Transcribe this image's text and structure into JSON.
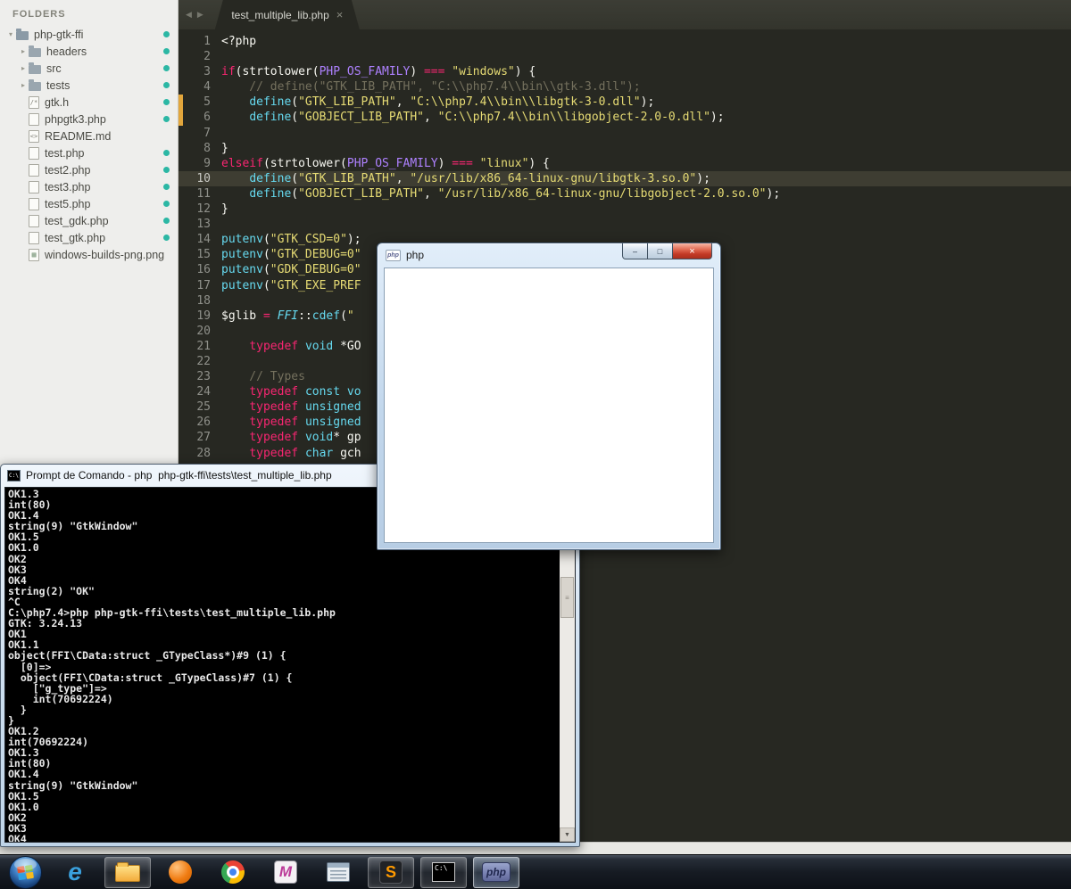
{
  "sidebar": {
    "header": "FOLDERS",
    "items": [
      {
        "label": "php-gtk-ffi",
        "icon": "folder-open",
        "arrow": "▾",
        "dot": true,
        "level": 0
      },
      {
        "label": "headers",
        "icon": "folder",
        "arrow": "▸",
        "dot": true,
        "level": 1
      },
      {
        "label": "src",
        "icon": "folder",
        "arrow": "▸",
        "dot": true,
        "level": 1
      },
      {
        "label": "tests",
        "icon": "folder",
        "arrow": "▸",
        "dot": true,
        "level": 1
      },
      {
        "label": "gtk.h",
        "icon": "file",
        "glyph": "/*",
        "dot": true,
        "level": 1
      },
      {
        "label": "phpgtk3.php",
        "icon": "file",
        "glyph": "",
        "dot": true,
        "level": 1
      },
      {
        "label": "README.md",
        "icon": "file",
        "glyph": "<>",
        "dot": false,
        "level": 1
      },
      {
        "label": "test.php",
        "icon": "file",
        "glyph": "",
        "dot": true,
        "level": 1
      },
      {
        "label": "test2.php",
        "icon": "file",
        "glyph": "",
        "dot": true,
        "level": 1
      },
      {
        "label": "test3.php",
        "icon": "file",
        "glyph": "",
        "dot": true,
        "level": 1
      },
      {
        "label": "test5.php",
        "icon": "file",
        "glyph": "",
        "dot": true,
        "level": 1
      },
      {
        "label": "test_gdk.php",
        "icon": "file",
        "glyph": "",
        "dot": true,
        "level": 1
      },
      {
        "label": "test_gtk.php",
        "icon": "file",
        "glyph": "",
        "dot": true,
        "level": 1
      },
      {
        "label": "windows-builds-png.png",
        "icon": "image",
        "glyph": "▦",
        "dot": false,
        "level": 1
      }
    ]
  },
  "tabbar": {
    "left_arrow": "◀",
    "right_arrow": "▶",
    "tabs": [
      {
        "title": "test_multiple_lib.php",
        "close": "×",
        "active": true
      }
    ]
  },
  "editor": {
    "active_line": 10,
    "lines": [
      [
        [
          "w",
          "<?php"
        ]
      ],
      [],
      [
        [
          "p",
          "if"
        ],
        [
          "w",
          "(strtolower("
        ],
        [
          "pu",
          "PHP_OS_FAMILY"
        ],
        [
          "w",
          ") "
        ],
        [
          "p",
          "==="
        ],
        [
          "w",
          " "
        ],
        [
          "y",
          "\"windows\""
        ],
        [
          "w",
          ") {"
        ]
      ],
      [
        [
          "g",
          "    // define(\"GTK_LIB_PATH\", \"C:\\\\php7.4\\\\bin\\\\gtk-3.dll\");"
        ]
      ],
      [
        [
          "w",
          "    "
        ],
        [
          "b",
          "define"
        ],
        [
          "w",
          "("
        ],
        [
          "y",
          "\"GTK_LIB_PATH\""
        ],
        [
          "w",
          ", "
        ],
        [
          "y",
          "\"C:\\\\php7.4\\\\bin\\\\libgtk-3-0.dll\""
        ],
        [
          "w",
          ");"
        ]
      ],
      [
        [
          "w",
          "    "
        ],
        [
          "b",
          "define"
        ],
        [
          "w",
          "("
        ],
        [
          "y",
          "\"GOBJECT_LIB_PATH\""
        ],
        [
          "w",
          ", "
        ],
        [
          "y",
          "\"C:\\\\php7.4\\\\bin\\\\libgobject-2.0-0.dll\""
        ],
        [
          "w",
          ");"
        ]
      ],
      [],
      [
        [
          "w",
          "}"
        ]
      ],
      [
        [
          "p",
          "elseif"
        ],
        [
          "w",
          "(strtolower("
        ],
        [
          "pu",
          "PHP_OS_FAMILY"
        ],
        [
          "w",
          ") "
        ],
        [
          "p",
          "==="
        ],
        [
          "w",
          " "
        ],
        [
          "y",
          "\"linux\""
        ],
        [
          "w",
          ") {"
        ]
      ],
      [
        [
          "w",
          "    "
        ],
        [
          "b",
          "define"
        ],
        [
          "w",
          "("
        ],
        [
          "y",
          "\"GTK_LIB_PATH\""
        ],
        [
          "w",
          ", "
        ],
        [
          "y",
          "\"/usr/lib/x86_64-linux-gnu/libgtk-3.so.0\""
        ],
        [
          "w",
          ");"
        ]
      ],
      [
        [
          "w",
          "    "
        ],
        [
          "b",
          "define"
        ],
        [
          "w",
          "("
        ],
        [
          "y",
          "\"GOBJECT_LIB_PATH\""
        ],
        [
          "w",
          ", "
        ],
        [
          "y",
          "\"/usr/lib/x86_64-linux-gnu/libgobject-2.0.so.0\""
        ],
        [
          "w",
          ");"
        ]
      ],
      [
        [
          "w",
          "}"
        ]
      ],
      [],
      [
        [
          "b",
          "putenv"
        ],
        [
          "w",
          "("
        ],
        [
          "y",
          "\"GTK_CSD=0\""
        ],
        [
          "w",
          ");"
        ]
      ],
      [
        [
          "b",
          "putenv"
        ],
        [
          "w",
          "("
        ],
        [
          "y",
          "\"GTK_DEBUG=0\""
        ]
      ],
      [
        [
          "b",
          "putenv"
        ],
        [
          "w",
          "("
        ],
        [
          "y",
          "\"GDK_DEBUG=0\""
        ]
      ],
      [
        [
          "b",
          "putenv"
        ],
        [
          "w",
          "("
        ],
        [
          "y",
          "\"GTK_EXE_PREF"
        ]
      ],
      [],
      [
        [
          "w",
          "$glib "
        ],
        [
          "p",
          "="
        ],
        [
          "w",
          " "
        ],
        [
          "bi",
          "FFI"
        ],
        [
          "w",
          "::"
        ],
        [
          "b",
          "cdef"
        ],
        [
          "w",
          "("
        ],
        [
          "y",
          "\""
        ]
      ],
      [],
      [
        [
          "w",
          "    "
        ],
        [
          "p",
          "typedef"
        ],
        [
          "w",
          " "
        ],
        [
          "b",
          "void"
        ],
        [
          "w",
          " *GO"
        ]
      ],
      [],
      [
        [
          "g",
          "    // Types"
        ]
      ],
      [
        [
          "w",
          "    "
        ],
        [
          "p",
          "typedef"
        ],
        [
          "w",
          " "
        ],
        [
          "b",
          "const"
        ],
        [
          "w",
          " "
        ],
        [
          "b",
          "vo"
        ]
      ],
      [
        [
          "w",
          "    "
        ],
        [
          "p",
          "typedef"
        ],
        [
          "w",
          " "
        ],
        [
          "b",
          "unsigned"
        ]
      ],
      [
        [
          "w",
          "    "
        ],
        [
          "p",
          "typedef"
        ],
        [
          "w",
          " "
        ],
        [
          "b",
          "unsigned"
        ]
      ],
      [
        [
          "w",
          "    "
        ],
        [
          "p",
          "typedef"
        ],
        [
          "w",
          " "
        ],
        [
          "b",
          "void"
        ],
        [
          "w",
          "* gp"
        ]
      ],
      [
        [
          "w",
          "    "
        ],
        [
          "p",
          "typedef"
        ],
        [
          "w",
          " "
        ],
        [
          "b",
          "char"
        ],
        [
          "w",
          " gch"
        ]
      ]
    ]
  },
  "console": {
    "title": "Prompt de Comando - php  php-gtk-ffi\\tests\\test_multiple_lib.php",
    "icon_text": "C:\\",
    "scroll_up": "▲",
    "scroll_down": "▼",
    "thumb_grip": "≡",
    "lines": [
      "OK1.3",
      "int(80)",
      "OK1.4",
      "string(9) \"GtkWindow\"",
      "OK1.5",
      "OK1.0",
      "OK2",
      "OK3",
      "OK4",
      "string(2) \"OK\"",
      "^C",
      "C:\\php7.4>php php-gtk-ffi\\tests\\test_multiple_lib.php",
      "GTK: 3.24.13",
      "OK1",
      "OK1.1",
      "object(FFI\\CData:struct _GTypeClass*)#9 (1) {",
      "  [0]=>",
      "  object(FFI\\CData:struct _GTypeClass)#7 (1) {",
      "    [\"g_type\"]=>",
      "    int(70692224)",
      "  }",
      "}",
      "OK1.2",
      "int(70692224)",
      "OK1.3",
      "int(80)",
      "OK1.4",
      "string(9) \"GtkWindow\"",
      "OK1.5",
      "OK1.0",
      "OK2",
      "OK3",
      "OK4"
    ]
  },
  "gtk_window": {
    "title": "php",
    "icon_text": "php",
    "min": "–",
    "max": "□",
    "close": "×"
  },
  "taskbar": {
    "ie_glyph": "e",
    "m_glyph": "M",
    "sublime_glyph": "S",
    "cmd_glyph": "C:\\",
    "php_glyph": "php"
  }
}
